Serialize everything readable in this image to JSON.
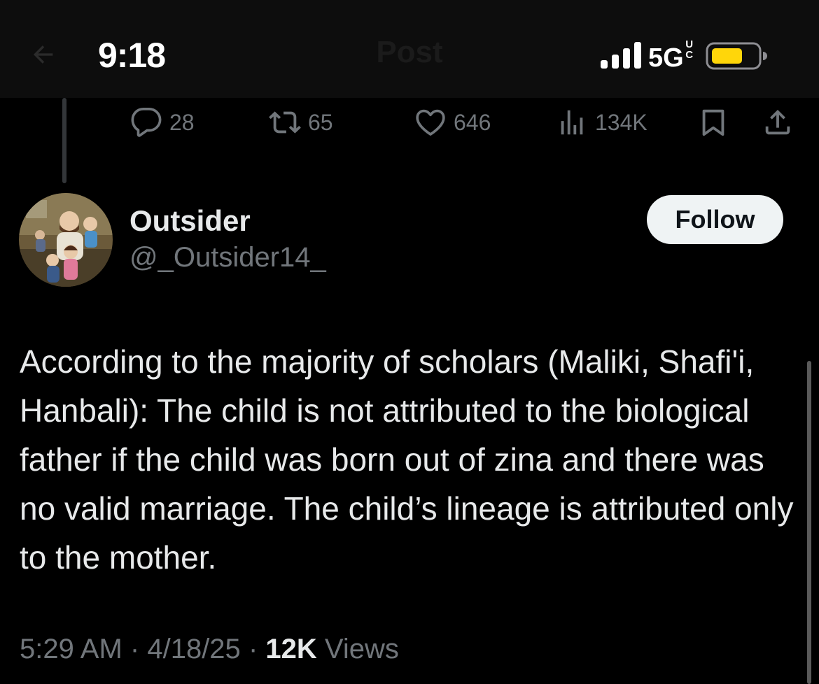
{
  "status_bar": {
    "time": "9:18",
    "network": "5G",
    "network_suffix_top": "U",
    "network_suffix_bottom": "C",
    "battery_color": "#ffd60a"
  },
  "nav": {
    "title": "Post",
    "back_icon": "arrow-left-icon"
  },
  "actions": {
    "replies": "28",
    "reposts": "65",
    "likes": "646",
    "views": "134K"
  },
  "author": {
    "name": "Outsider",
    "handle": "@_Outsider14_",
    "follow_label": "Follow"
  },
  "tweet": {
    "text": "According to the majority of scholars (Maliki, Shafi'i, Hanbali): The child is not attributed to the biological father if the child was born out of zina and there was no valid marriage. The child’s lineage is attributed only to the mother.",
    "time": "5:29 AM",
    "date": "4/18/25",
    "separator": "·",
    "views_count": "12K",
    "views_label": "Views"
  },
  "colors": {
    "background": "#000000",
    "text": "#e7e9ea",
    "muted": "#71767b",
    "button_bg": "#eff3f4"
  }
}
